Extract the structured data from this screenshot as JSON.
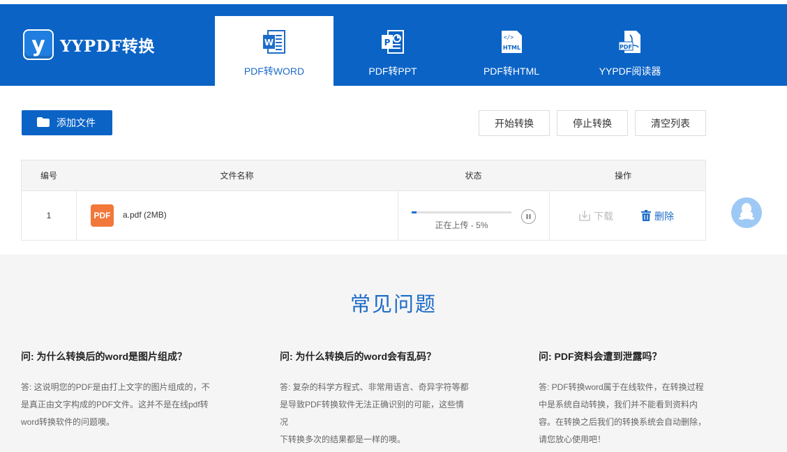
{
  "brand": {
    "logo_letter": "y",
    "name": "YYPDF转换"
  },
  "tabs": [
    {
      "label": "PDF转WORD",
      "icon": "word-icon",
      "active": true
    },
    {
      "label": "PDF转PPT",
      "icon": "ppt-icon",
      "active": false
    },
    {
      "label": "PDF转HTML",
      "icon": "html-icon",
      "active": false
    },
    {
      "label": "YYPDF阅读器",
      "icon": "pdf-reader-icon",
      "active": false
    }
  ],
  "toolbar": {
    "add_file": "添加文件",
    "start": "开始转换",
    "stop": "停止转换",
    "clear": "清空列表"
  },
  "table": {
    "headers": {
      "num": "编号",
      "name": "文件名称",
      "status": "状态",
      "action": "操作"
    },
    "rows": [
      {
        "num": "1",
        "badge": "PDF",
        "name": "a.pdf (2MB)",
        "progress": 0.05,
        "status": "正在上传 - 5%",
        "download": "下载",
        "delete": "删除"
      }
    ]
  },
  "faq": {
    "title": "常见问题",
    "items": [
      {
        "q": "问: 为什么转换后的word是图片组成？",
        "a": [
          "答: 这说明您的PDF是由打上文字的图片组成的，不",
          "是真正由文字构成的PDF文件。这并不是在线pdf转",
          "word转换软件的问题噢。"
        ]
      },
      {
        "q": "问: 为什么转换后的word会有乱码？",
        "a": [
          "答: 复杂的科学方程式、非常用语言、奇异字符等都",
          "是导致PDF转换软件无法正确识别的可能，这些情况",
          "下转换多次的结果都是一样的噢。"
        ]
      },
      {
        "q": "问: PDF资料会遭到泄露吗？",
        "a": [
          "答: PDF转换word属于在线软件，在转换过程",
          "中是系统自动转换，我们并不能看到资料内",
          "容。在转换之后我们的转换系统会自动删除，",
          "请您放心使用吧！"
        ]
      }
    ]
  },
  "colors": {
    "brand_blue": "#0b63c6",
    "link_blue": "#1d6cc8",
    "pdf_orange": "#f2773a"
  }
}
